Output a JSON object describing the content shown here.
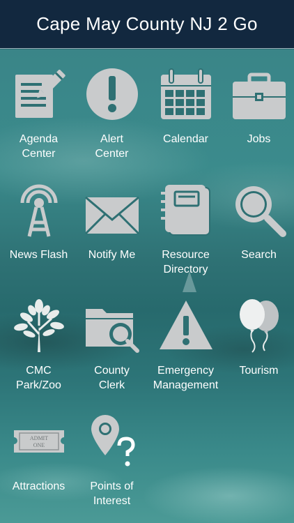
{
  "header": {
    "title": "Cape May County NJ 2 Go"
  },
  "colors": {
    "header_bg": "#12283f",
    "icon_fill": "#c9cbcc",
    "text": "#ffffff"
  },
  "tiles": [
    {
      "label": "Agenda\nCenter",
      "icon": "agenda-icon"
    },
    {
      "label": "Alert\nCenter",
      "icon": "alert-icon"
    },
    {
      "label": "Calendar",
      "icon": "calendar-icon"
    },
    {
      "label": "Jobs",
      "icon": "briefcase-icon"
    },
    {
      "label": "News Flash",
      "icon": "broadcast-tower-icon"
    },
    {
      "label": "Notify Me",
      "icon": "envelope-icon"
    },
    {
      "label": "Resource\nDirectory",
      "icon": "notebook-icon"
    },
    {
      "label": "Search",
      "icon": "magnifier-icon"
    },
    {
      "label": "CMC\nPark/Zoo",
      "icon": "tree-icon"
    },
    {
      "label": "County\nClerk",
      "icon": "folder-search-icon"
    },
    {
      "label": "Emergency\nManagement",
      "icon": "warning-triangle-icon"
    },
    {
      "label": "Tourism",
      "icon": "balloons-icon"
    },
    {
      "label": "Attractions",
      "icon": "ticket-icon",
      "ticket_text": "ADMIT\nONE"
    },
    {
      "label": "Points of\nInterest",
      "icon": "map-pin-question-icon"
    }
  ]
}
